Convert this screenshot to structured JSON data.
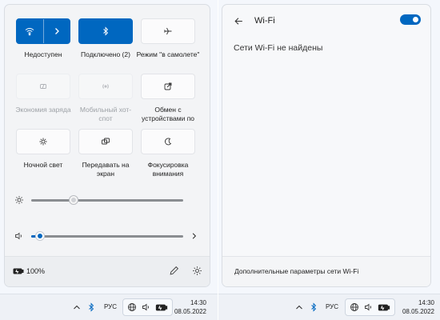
{
  "colors": {
    "accent": "#0067c0",
    "panel_bg": "#f3f4f6",
    "taskbar_bg": "#eef1f6"
  },
  "quick_settings": {
    "tiles": [
      {
        "id": "wifi",
        "label": "Недоступен",
        "icon": "wifi-icon",
        "state": "on",
        "has_arrow": true
      },
      {
        "id": "bluetooth",
        "label": "Подключено (2)",
        "icon": "bluetooth-icon",
        "state": "on"
      },
      {
        "id": "airplane",
        "label": "Режим \"в самолете\"",
        "icon": "airplane-icon",
        "state": "off"
      },
      {
        "id": "battery-saver",
        "label": "Экономия заряда",
        "icon": "battery-saver-icon",
        "state": "disabled"
      },
      {
        "id": "hotspot",
        "label": "Мобильный хот-спот",
        "icon": "hotspot-icon",
        "state": "disabled"
      },
      {
        "id": "nearby-share",
        "label": "Обмен с устройствами по",
        "icon": "share-icon",
        "state": "off"
      },
      {
        "id": "night-light",
        "label": "Ночной свет",
        "icon": "night-light-icon",
        "state": "off"
      },
      {
        "id": "cast",
        "label": "Передавать на экран",
        "icon": "cast-icon",
        "state": "off"
      },
      {
        "id": "focus",
        "label": "Фокусировка внимания",
        "icon": "moon-icon",
        "state": "off"
      }
    ],
    "brightness": {
      "icon": "sun-icon",
      "value": 0.28
    },
    "volume": {
      "icon": "speaker-icon",
      "value": 0.05,
      "arrow_icon": "chevron-right-icon"
    },
    "footer": {
      "battery_icon": "battery-icon",
      "battery_text": "100%",
      "edit_icon": "pencil-icon",
      "settings_icon": "gear-icon"
    }
  },
  "wifi_panel": {
    "back_icon": "back-arrow-icon",
    "title": "Wi-Fi",
    "toggle_on": true,
    "message": "Сети Wi-Fi не найдены",
    "footer_link": "Дополнительные параметры сети Wi-Fi"
  },
  "taskbar": {
    "chevron_icon": "chevron-up-icon",
    "bluetooth_icon": "bluetooth-icon",
    "lang": "РУС",
    "network_icon": "globe-icon",
    "sound_icon": "speaker-icon",
    "battery_icon": "battery-icon",
    "time": "14:30",
    "date": "08.05.2022"
  }
}
